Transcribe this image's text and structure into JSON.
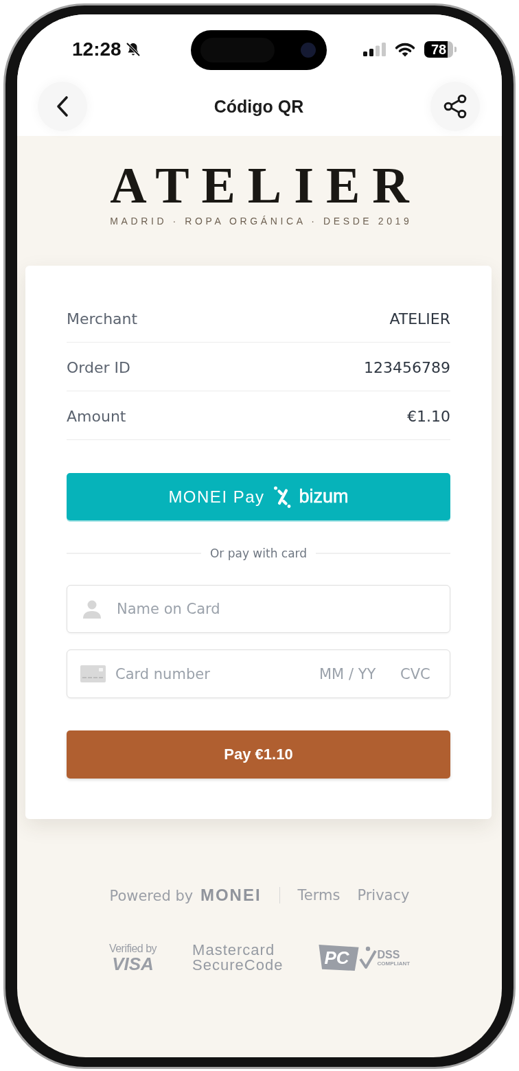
{
  "status_bar": {
    "time": "12:28",
    "battery": "78"
  },
  "header": {
    "title": "Código QR"
  },
  "brand": {
    "name": "ATELIER",
    "tagline": "MADRID · ROPA ORGÁNICA · DESDE 2019"
  },
  "summary": [
    {
      "label": "Merchant",
      "value": "ATELIER"
    },
    {
      "label": "Order ID",
      "value": "123456789"
    },
    {
      "label": "Amount",
      "value": "€1.10"
    }
  ],
  "wallet_button": {
    "label": "MONEI Pay",
    "brand": "bizum"
  },
  "divider": "Or pay with card",
  "fields": [
    {
      "kind": "name",
      "placeholder": "Name on Card"
    },
    {
      "kind": "card",
      "placeholder": "Card number",
      "expiry_placeholder": "MM / YY",
      "cvc_placeholder": "CVC"
    }
  ],
  "pay_button": "Pay €1.10",
  "footer": {
    "powered_by": "Powered by **MONEI**",
    "links": [
      "Terms",
      "Privacy"
    ]
  },
  "badges": [
    {
      "kind": "visa",
      "lines": [
        "Verified by",
        "VISA"
      ]
    },
    {
      "kind": "mastercard",
      "lines": [
        "Mastercard",
        "SecureCode"
      ]
    },
    {
      "kind": "pci",
      "lines": [
        "PC",
        "DSS",
        "COMPLIANT"
      ]
    }
  ]
}
